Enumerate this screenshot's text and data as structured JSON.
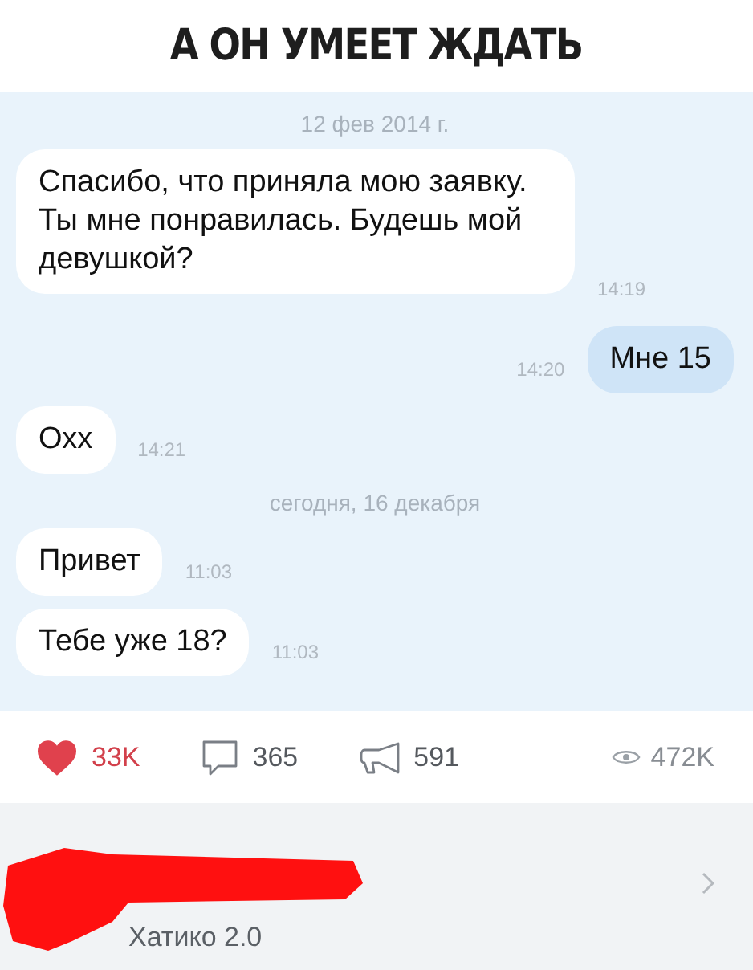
{
  "caption": "А ОН УМЕЕТ ЖДАТЬ",
  "messages": [
    {
      "kind": "date",
      "text": "12 фев 2014 г."
    },
    {
      "kind": "in",
      "text": "Спасибо, что приняла мою заявку. Ты мне понравилась. Будешь мой девушкой?",
      "time": "14:19"
    },
    {
      "kind": "out",
      "text": "Мне 15",
      "time": "14:20"
    },
    {
      "kind": "in",
      "text": "Охх",
      "time": "14:21"
    },
    {
      "kind": "date",
      "text": "сегодня, 16 декабря"
    },
    {
      "kind": "in",
      "text": "Привет",
      "time": "11:03"
    },
    {
      "kind": "in",
      "text": "Тебе уже 18?",
      "time": "11:03"
    }
  ],
  "stats": {
    "likes": "33K",
    "liked": true,
    "comments": "365",
    "reposts": "591",
    "views": "472K"
  },
  "author": {
    "name": "Хатико 2.0"
  }
}
